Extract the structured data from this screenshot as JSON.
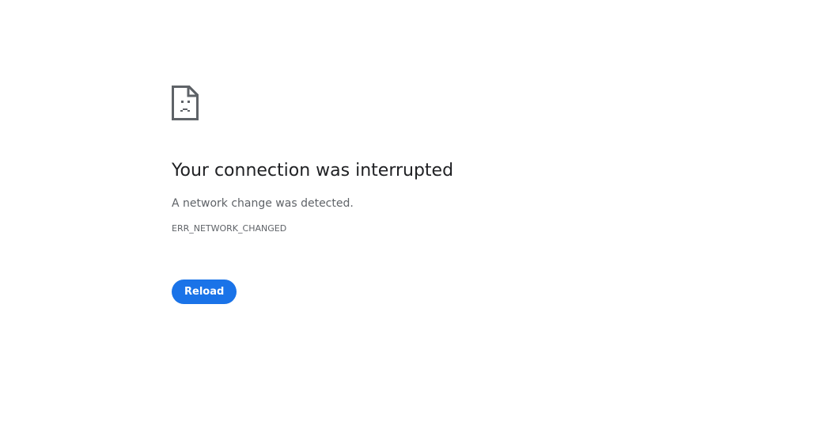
{
  "error": {
    "icon": "sad-page-icon",
    "title": "Your connection was interrupted",
    "message": "A network change was detected.",
    "code": "ERR_NETWORK_CHANGED"
  },
  "actions": {
    "reload_label": "Reload"
  },
  "colors": {
    "button_bg": "#1a73e8",
    "title_text": "#202124",
    "body_text": "#5f6368"
  }
}
